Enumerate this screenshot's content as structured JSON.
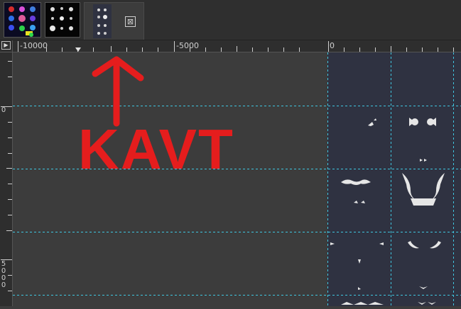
{
  "image_tabs": [
    {
      "name": "color-sprite-sheet-thumbnail",
      "active": false
    },
    {
      "name": "white-sprite-sheet-thumbnail",
      "active": false
    },
    {
      "name": "current-image-thumbnail",
      "active": true
    }
  ],
  "close_tab_glyph": "⊠",
  "navigate_button_glyph": "▶",
  "horizontal_ruler": {
    "labels": [
      "-10000",
      "-5000",
      "0"
    ]
  },
  "vertical_ruler": {
    "labels": [
      "0",
      "5000"
    ]
  },
  "annotation": {
    "text": "KAVT",
    "color": "#e51d1d"
  },
  "guide_color": "#3fc6e0",
  "canvas_background": "#3c3c3c",
  "image_background": "#2f3241"
}
